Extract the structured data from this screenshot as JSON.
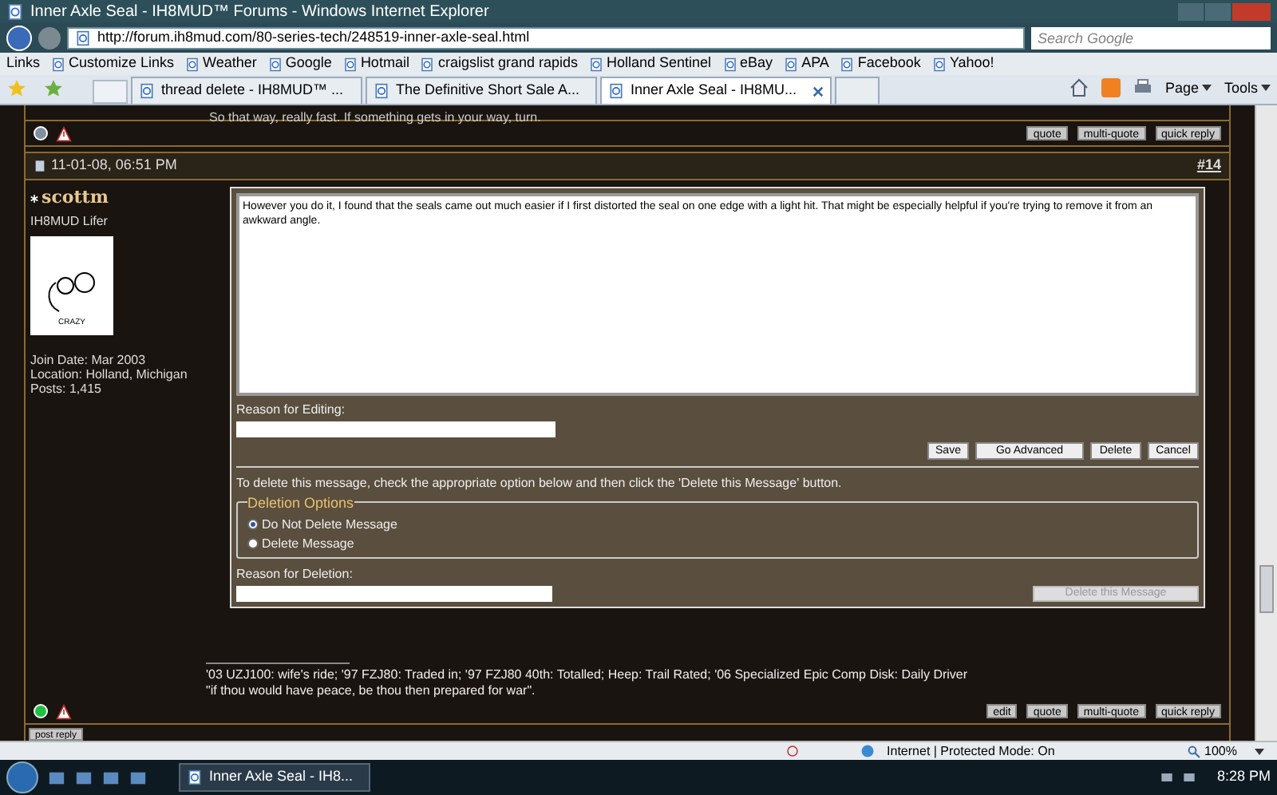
{
  "window": {
    "title": "Inner Axle Seal - IH8MUD™ Forums - Windows Internet Explorer"
  },
  "address": {
    "url": "http://forum.ih8mud.com/80-series-tech/248519-inner-axle-seal.html",
    "search_placeholder": "Search Google"
  },
  "links_bar": {
    "label": "Links",
    "items": [
      "Customize Links",
      "Weather",
      "Google",
      "Hotmail",
      "craigslist grand rapids",
      "Holland Sentinel",
      "eBay",
      "APA",
      "Facebook",
      "Yahoo!"
    ]
  },
  "tabs": [
    {
      "label": "thread delete - IH8MUD™ ...",
      "selected": false
    },
    {
      "label": "The Definitive Short Sale A...",
      "selected": false
    },
    {
      "label": "Inner Axle Seal - IH8MU...",
      "selected": true
    }
  ],
  "tools": [
    "Page",
    "Tools"
  ],
  "previous_post": {
    "text": "So that way, really fast. If something gets in your way, turn.",
    "buttons": [
      "quote",
      "multi-quote",
      "quick reply"
    ]
  },
  "post": {
    "date": "11-01-08, 06:51 PM",
    "number": "14",
    "number_prefix": "#",
    "user": {
      "name": "scottm",
      "title": "IH8MUD Lifer",
      "avatar_caption": "CRAZY",
      "online": true,
      "details": [
        "Join Date: Mar 2003",
        "Location: Holland, Michigan",
        "Posts: 1,415"
      ]
    },
    "editor": {
      "text": "However you do it, I found that the seals came out much easier if I first distorted the seal on one edge with a light hit.  That might be especially helpful if you're trying to remove it from an awkward angle.",
      "reason_label": "Reason for Editing:",
      "buttons": [
        "Save",
        "Go Advanced",
        "Delete",
        "Cancel"
      ],
      "delete_hint": "To delete this message, check the appropriate option below and then click the 'Delete this Message' button.",
      "options_legend": "Deletion Options",
      "options": [
        {
          "label": "Do Not Delete Message",
          "selected": true
        },
        {
          "label": "Delete Message",
          "selected": false
        }
      ],
      "deletion_reason_label": "Reason for Deletion:",
      "delete_button": {
        "label": "Delete this Message",
        "disabled": true
      }
    },
    "signature": [
      "'03 UZJ100: wife's ride; '97 FZJ80: Traded in; '97 FZJ80 40th: Totalled; Heep: Trail Rated; '06 Specialized Epic Comp Disk: Daily Driver",
      "\"if thou would have peace, be thou then prepared for war\"."
    ],
    "buttons": [
      "edit",
      "quote",
      "multi-quote",
      "quick reply"
    ]
  },
  "post_reply": "post reply",
  "status_bar": {
    "zone": "Internet | Protected Mode: On",
    "zoom": "100%"
  },
  "taskbar": {
    "window": "Inner Axle Seal - IH8...",
    "time": "8:28 PM"
  }
}
